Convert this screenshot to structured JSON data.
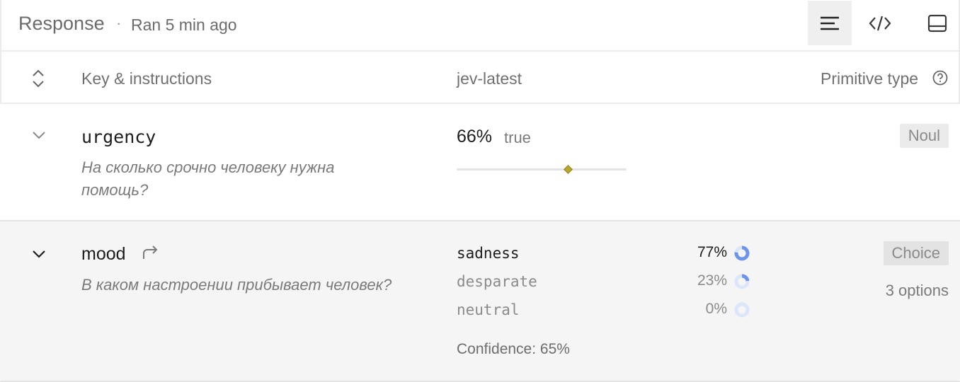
{
  "header": {
    "title": "Response",
    "separator": "·",
    "ran_text": "Ran 5 min ago",
    "tools": [
      {
        "name": "list-view",
        "active": true
      },
      {
        "name": "code-view",
        "active": false
      },
      {
        "name": "panel-view",
        "active": false
      }
    ]
  },
  "columns": {
    "key": "Key & instructions",
    "model": "jev-latest",
    "type": "Primitive type"
  },
  "rows": [
    {
      "key": "urgency",
      "instruction": "На сколько срочно человеку нужна помощь?",
      "value_pct": "66%",
      "value_label": "true",
      "slider_fraction": 0.66,
      "type_badge": "Noul"
    },
    {
      "key": "mood",
      "instruction": "В каком настроении прибывает человек?",
      "options": [
        {
          "name": "sadness",
          "pct": "77%",
          "fraction": 0.77
        },
        {
          "name": "desparate",
          "pct": "23%",
          "fraction": 0.23
        },
        {
          "name": "neutral",
          "pct": "0%",
          "fraction": 0.0
        }
      ],
      "confidence": "Confidence: 65%",
      "type_badge": "Choice",
      "type_meta": "3 options"
    }
  ],
  "colors": {
    "accent_ring": "#6f95ea",
    "ring_track": "#dce6fb",
    "slider_thumb": "#b9a82a"
  }
}
